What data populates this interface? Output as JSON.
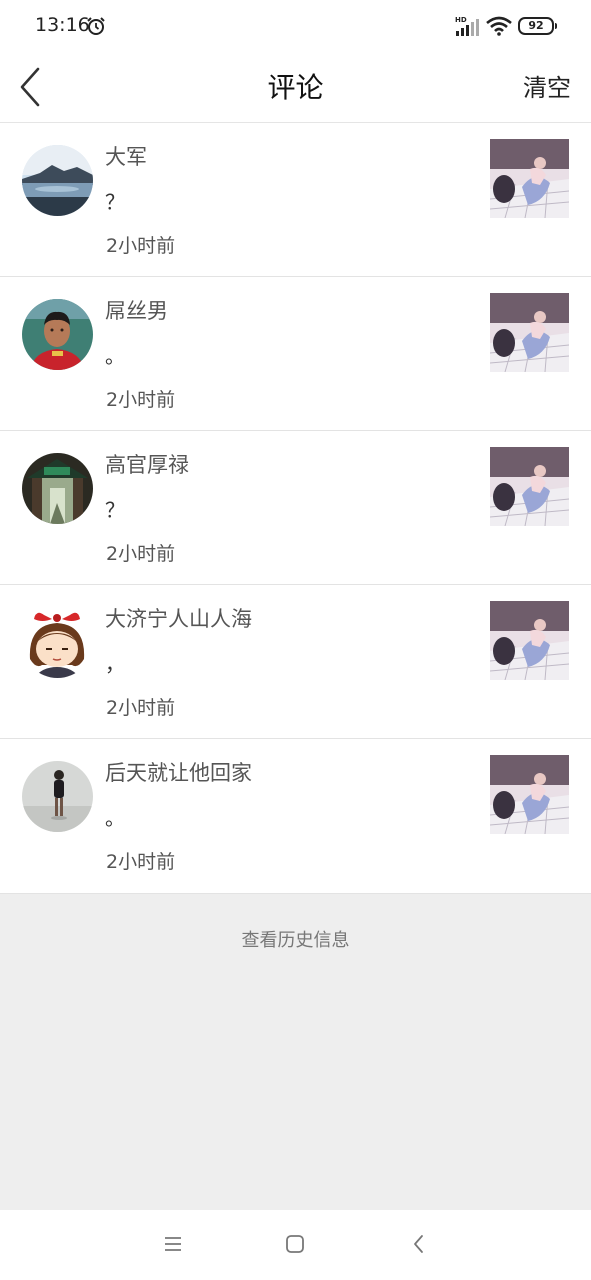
{
  "status_bar": {
    "time": "13:16",
    "battery": "92",
    "icons": [
      "alarm-icon",
      "hd-signal-icon",
      "wifi-icon",
      "battery-icon"
    ]
  },
  "header": {
    "back_icon": "chevron-left-icon",
    "title": "评论",
    "clear_label": "清空"
  },
  "comments": [
    {
      "username": "大军",
      "text": "？",
      "time": "2小时前",
      "avatar": "landscape-lake-avatar"
    },
    {
      "username": "屌丝男",
      "text": "。",
      "time": "2小时前",
      "avatar": "football-player-avatar"
    },
    {
      "username": "高官厚禄",
      "text": "？",
      "time": "2小时前",
      "avatar": "building-gate-avatar"
    },
    {
      "username": "大济宁人山人海",
      "text": "，",
      "time": "2小时前",
      "avatar": "cartoon-girl-avatar"
    },
    {
      "username": "后天就让他回家",
      "text": "。",
      "time": "2小时前",
      "avatar": "child-standing-avatar"
    }
  ],
  "history_link": "查看历史信息",
  "nav_bar": {
    "icons": [
      "menu-icon",
      "home-square-icon",
      "back-chevron-icon"
    ]
  },
  "colors": {
    "background": "#eeeeee",
    "card": "#ffffff",
    "username": "#555555",
    "divider": "#e3e3e3"
  }
}
